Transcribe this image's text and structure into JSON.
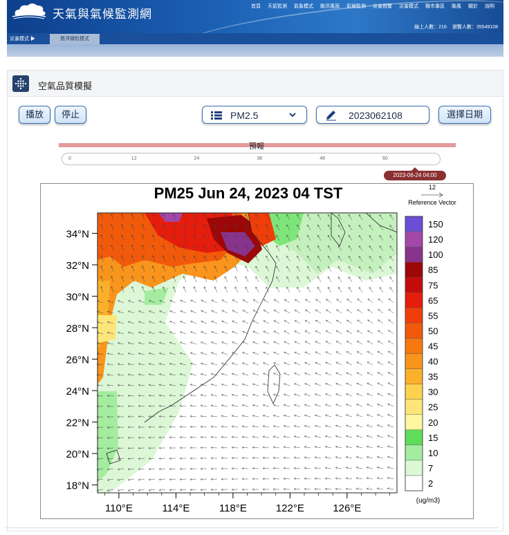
{
  "header": {
    "site_title": "天氣與氣候監測網",
    "nav": [
      "首頁",
      "天氣監測",
      "氣象模式",
      "颱洪風雨",
      "氣候監測",
      "災害預警",
      "災害模式",
      "縣市專區",
      "颱風",
      "關於",
      "說明"
    ],
    "online_users": "線上人數：216",
    "total_visits": "瀏覽人數：35549108",
    "breadcrumb": "災害模式 ▶",
    "subtab": "懸浮微粒模式"
  },
  "panel": {
    "title": "空氣品質模擬",
    "play_label": "播放",
    "stop_label": "停止",
    "species_select": "PM2.5",
    "date_value": "2023062108",
    "choose_date_label": "選擇日期",
    "forecast_label": "預報",
    "timeline_ticks": [
      "0",
      "12",
      "24",
      "36",
      "48",
      "60"
    ],
    "timeline_position_hours": 64,
    "timeline_tooltip": "2023-06-24 04:00"
  },
  "chart_data": {
    "type": "heatmap",
    "title": "PM25 Jun 24, 2023 04 TST",
    "x_tick_labels": [
      "110°E",
      "114°E",
      "118°E",
      "122°E",
      "126°E"
    ],
    "y_tick_labels": [
      "18°N",
      "20°N",
      "22°N",
      "24°N",
      "26°N",
      "28°N",
      "30°N",
      "32°N",
      "34°N"
    ],
    "xlim": [
      108.5,
      129.5
    ],
    "ylim": [
      17.5,
      35.3
    ],
    "reference_vector_value": "12",
    "reference_vector_label": "Reference Vector",
    "colorbar_levels": [
      "2",
      "7",
      "10",
      "15",
      "20",
      "25",
      "30",
      "35",
      "40",
      "45",
      "50",
      "55",
      "65",
      "75",
      "85",
      "100",
      "120",
      "150"
    ],
    "colorbar_unit": "(ug/m3)",
    "colorbar_colors": [
      "#ffffff",
      "#dcf7d6",
      "#a4eca0",
      "#5fdc5a",
      "#fff8a0",
      "#fde678",
      "#fcd24e",
      "#fbb02c",
      "#f9941c",
      "#f6780f",
      "#f25a0b",
      "#ef3e0a",
      "#e51d0c",
      "#c40b0b",
      "#9c0707",
      "#88348d",
      "#a347a9",
      "#6a4fd6"
    ]
  }
}
